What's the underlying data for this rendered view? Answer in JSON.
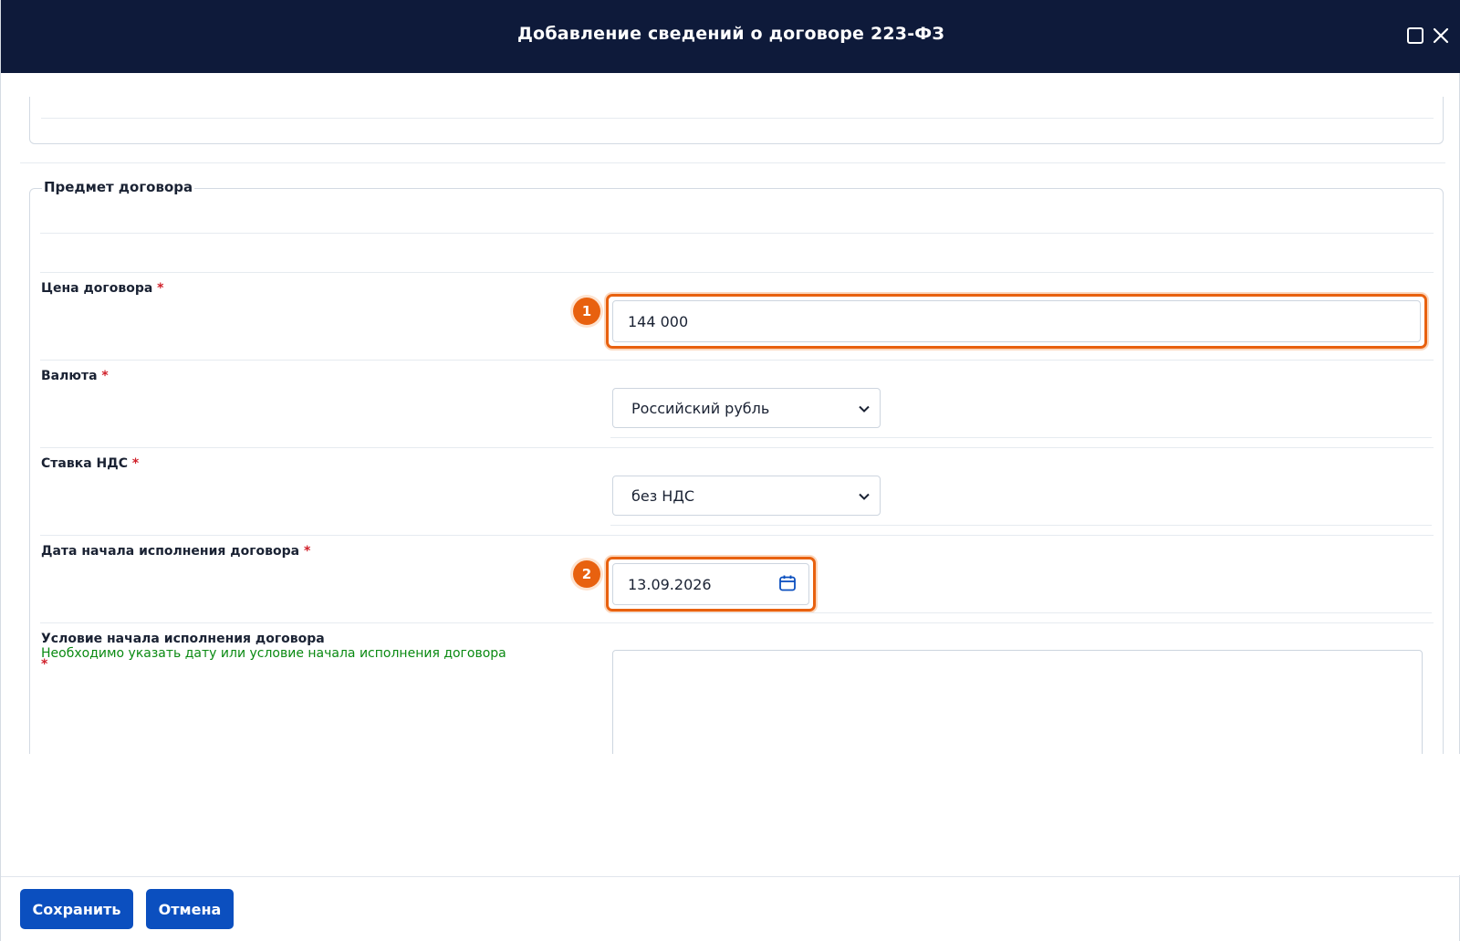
{
  "dialog": {
    "title": "Добавление сведений о договоре 223-ФЗ"
  },
  "section": {
    "legend": "Предмет договора"
  },
  "fields": {
    "price": {
      "label": "Цена договора",
      "required": "*",
      "value": "144 000",
      "badge": "1"
    },
    "currency": {
      "label": "Валюта",
      "required": "*",
      "selected": "Российский рубль"
    },
    "vat": {
      "label": "Ставка НДС",
      "required": "*",
      "selected": "без НДС"
    },
    "start_date": {
      "label": "Дата начала исполнения договора",
      "required": "*",
      "value": "13.09.2026",
      "badge": "2"
    },
    "start_condition": {
      "label": "Условие начала исполнения договора",
      "hint": "Необходимо указать дату или условие начала исполнения договора",
      "required": "*",
      "value": ""
    }
  },
  "footer": {
    "save_label": "Сохранить",
    "cancel_label": "Отмена"
  },
  "colors": {
    "header_bg": "#0e1a3a",
    "button_bg": "#0b4fbf",
    "highlight": "#e8610f",
    "required": "#d0202a",
    "hint": "#0a8a12"
  },
  "icons": {
    "maximize": "maximize-icon",
    "close": "close-icon",
    "calendar": "calendar-icon",
    "chevron": "chevron-down-icon"
  }
}
